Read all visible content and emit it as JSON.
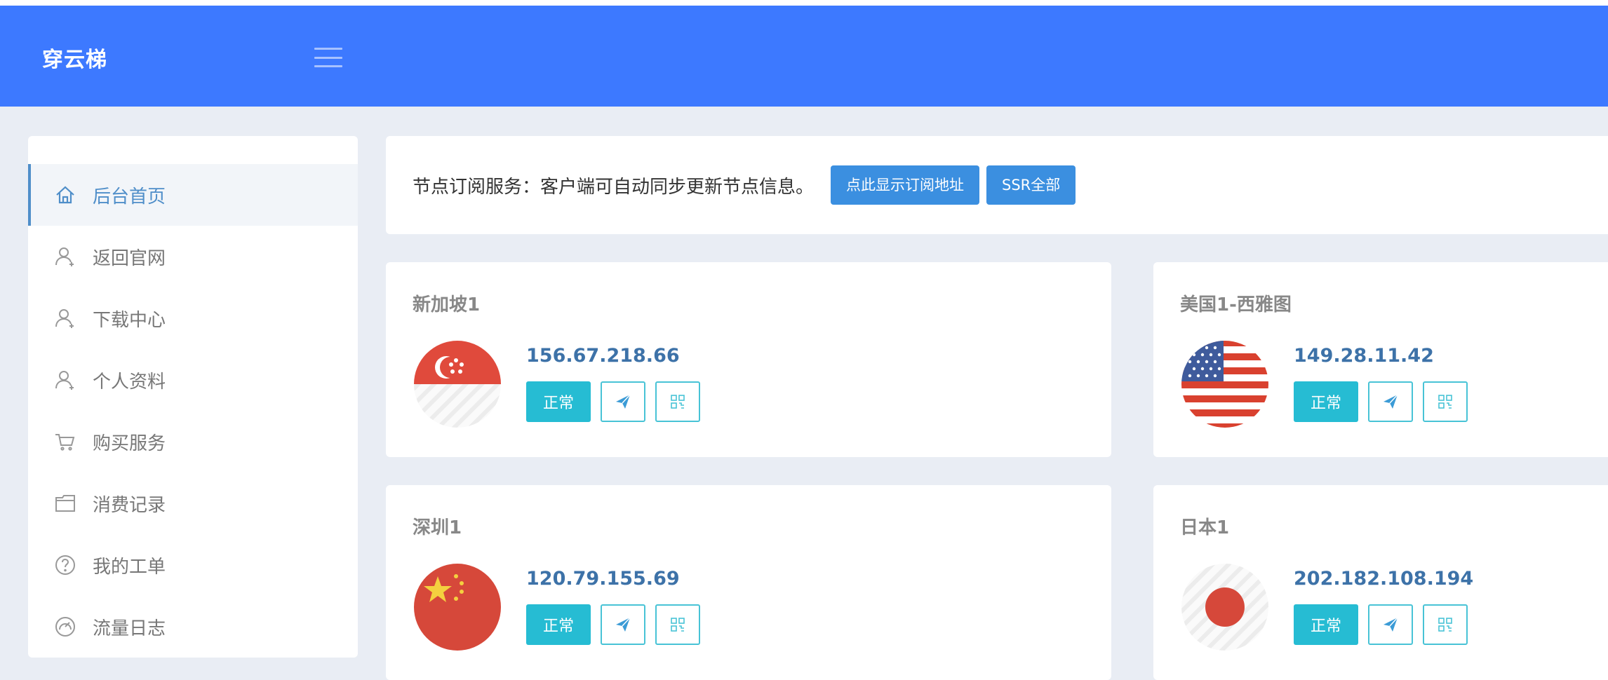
{
  "header": {
    "brand": "穿云梯"
  },
  "sidebar": {
    "items": [
      {
        "label": "后台首页",
        "icon": "home-icon"
      },
      {
        "label": "返回官网",
        "icon": "user-icon"
      },
      {
        "label": "下载中心",
        "icon": "user-icon"
      },
      {
        "label": "个人资料",
        "icon": "user-icon"
      },
      {
        "label": "购买服务",
        "icon": "cart-icon"
      },
      {
        "label": "消费记录",
        "icon": "folder-icon"
      },
      {
        "label": "我的工单",
        "icon": "help-icon"
      },
      {
        "label": "流量日志",
        "icon": "gauge-icon"
      }
    ]
  },
  "subscription": {
    "text": "节点订阅服务：客户端可自动同步更新节点信息。",
    "show_button": "点此显示订阅地址",
    "ssr_button": "SSR全部"
  },
  "nodes": [
    {
      "name": "新加坡1",
      "ip": "156.67.218.66",
      "status": "正常",
      "flag": "singapore-flag"
    },
    {
      "name": "美国1-西雅图",
      "ip": "149.28.11.42",
      "status": "正常",
      "flag": "usa-flag"
    },
    {
      "name": "深圳1",
      "ip": "120.79.155.69",
      "status": "正常",
      "flag": "china-flag"
    },
    {
      "name": "日本1",
      "ip": "202.182.108.194",
      "status": "正常",
      "flag": "japan-flag"
    }
  ],
  "colors": {
    "header": "#3d79ff",
    "status": "#26bcd3",
    "ip": "#3d72a8",
    "button": "#3b8fe0"
  }
}
